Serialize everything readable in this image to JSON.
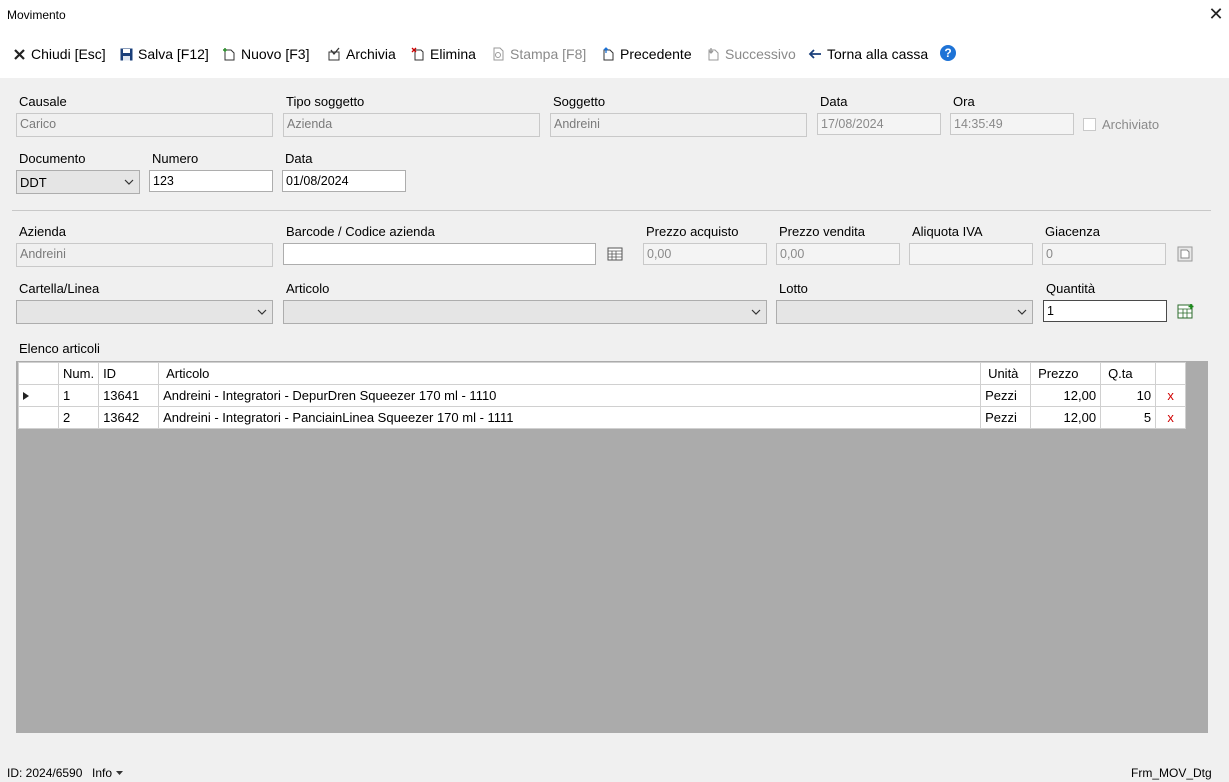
{
  "window": {
    "title": "Movimento"
  },
  "toolbar": {
    "close_label": "Chiudi [Esc]",
    "save_label": "Salva [F12]",
    "new_label": "Nuovo [F3]",
    "archive_label": "Archivia",
    "delete_label": "Elimina",
    "print_label": "Stampa [F8]",
    "previous_label": "Precedente",
    "next_label": "Successivo",
    "back_label": "Torna alla cassa"
  },
  "header": {
    "causale": {
      "label": "Causale",
      "value": "Carico"
    },
    "tipo_soggetto": {
      "label": "Tipo soggetto",
      "value": "Azienda"
    },
    "soggetto": {
      "label": "Soggetto",
      "value": "Andreini"
    },
    "data": {
      "label": "Data",
      "value": "17/08/2024"
    },
    "ora": {
      "label": "Ora",
      "value": "14:35:49"
    },
    "archiviato": {
      "label": "Archiviato",
      "checked": false
    }
  },
  "documento": {
    "tipo": {
      "label": "Documento",
      "value": "DDT"
    },
    "numero": {
      "label": "Numero",
      "value": "123"
    },
    "data": {
      "label": "Data",
      "value": "01/08/2024"
    }
  },
  "articolo_form": {
    "azienda": {
      "label": "Azienda",
      "value": "Andreini"
    },
    "barcode": {
      "label": "Barcode / Codice azienda",
      "value": ""
    },
    "prezzo_acquisto": {
      "label": "Prezzo acquisto",
      "value": "0,00"
    },
    "prezzo_vendita": {
      "label": "Prezzo vendita",
      "value": "0,00"
    },
    "aliquota_iva": {
      "label": "Aliquota IVA",
      "value": ""
    },
    "giacenza": {
      "label": "Giacenza",
      "value": "0"
    },
    "cartella": {
      "label": "Cartella/Linea",
      "value": ""
    },
    "articolo": {
      "label": "Articolo",
      "value": ""
    },
    "lotto": {
      "label": "Lotto",
      "value": ""
    },
    "quantita": {
      "label": "Quantità",
      "value": "1"
    }
  },
  "elenco": {
    "title": "Elenco articoli",
    "columns": [
      "",
      "Num.",
      "ID",
      "Articolo",
      "Unità",
      "Prezzo",
      "Q.ta",
      ""
    ],
    "rows": [
      {
        "num": "1",
        "id": "13641",
        "articolo": "Andreini  - Integratori - DepurDren Squeezer 170 ml - 1110",
        "unita": "Pezzi",
        "prezzo": "12,00",
        "qta": "10",
        "del": "x",
        "current": true
      },
      {
        "num": "2",
        "id": "13642",
        "articolo": "Andreini  - Integratori - PanciainLinea Squeezer 170 ml - 1111",
        "unita": "Pezzi",
        "prezzo": "12,00",
        "qta": "5",
        "del": "x",
        "current": false
      }
    ]
  },
  "status": {
    "id_text": "ID: 2024/6590",
    "info_label": "Info",
    "form_name": "Frm_MOV_Dtg"
  },
  "icons": {
    "close": "close-icon",
    "save": "floppy-icon",
    "new": "new-doc-icon",
    "archive": "archive-icon",
    "delete": "delete-doc-icon",
    "print": "print-icon",
    "previous": "previous-doc-icon",
    "next": "next-doc-icon",
    "back": "arrow-left-icon",
    "help": "help-icon"
  },
  "colors": {
    "help_blue": "#1e73d6",
    "delete_red": "#d00000",
    "grid_bg": "#ababab"
  }
}
